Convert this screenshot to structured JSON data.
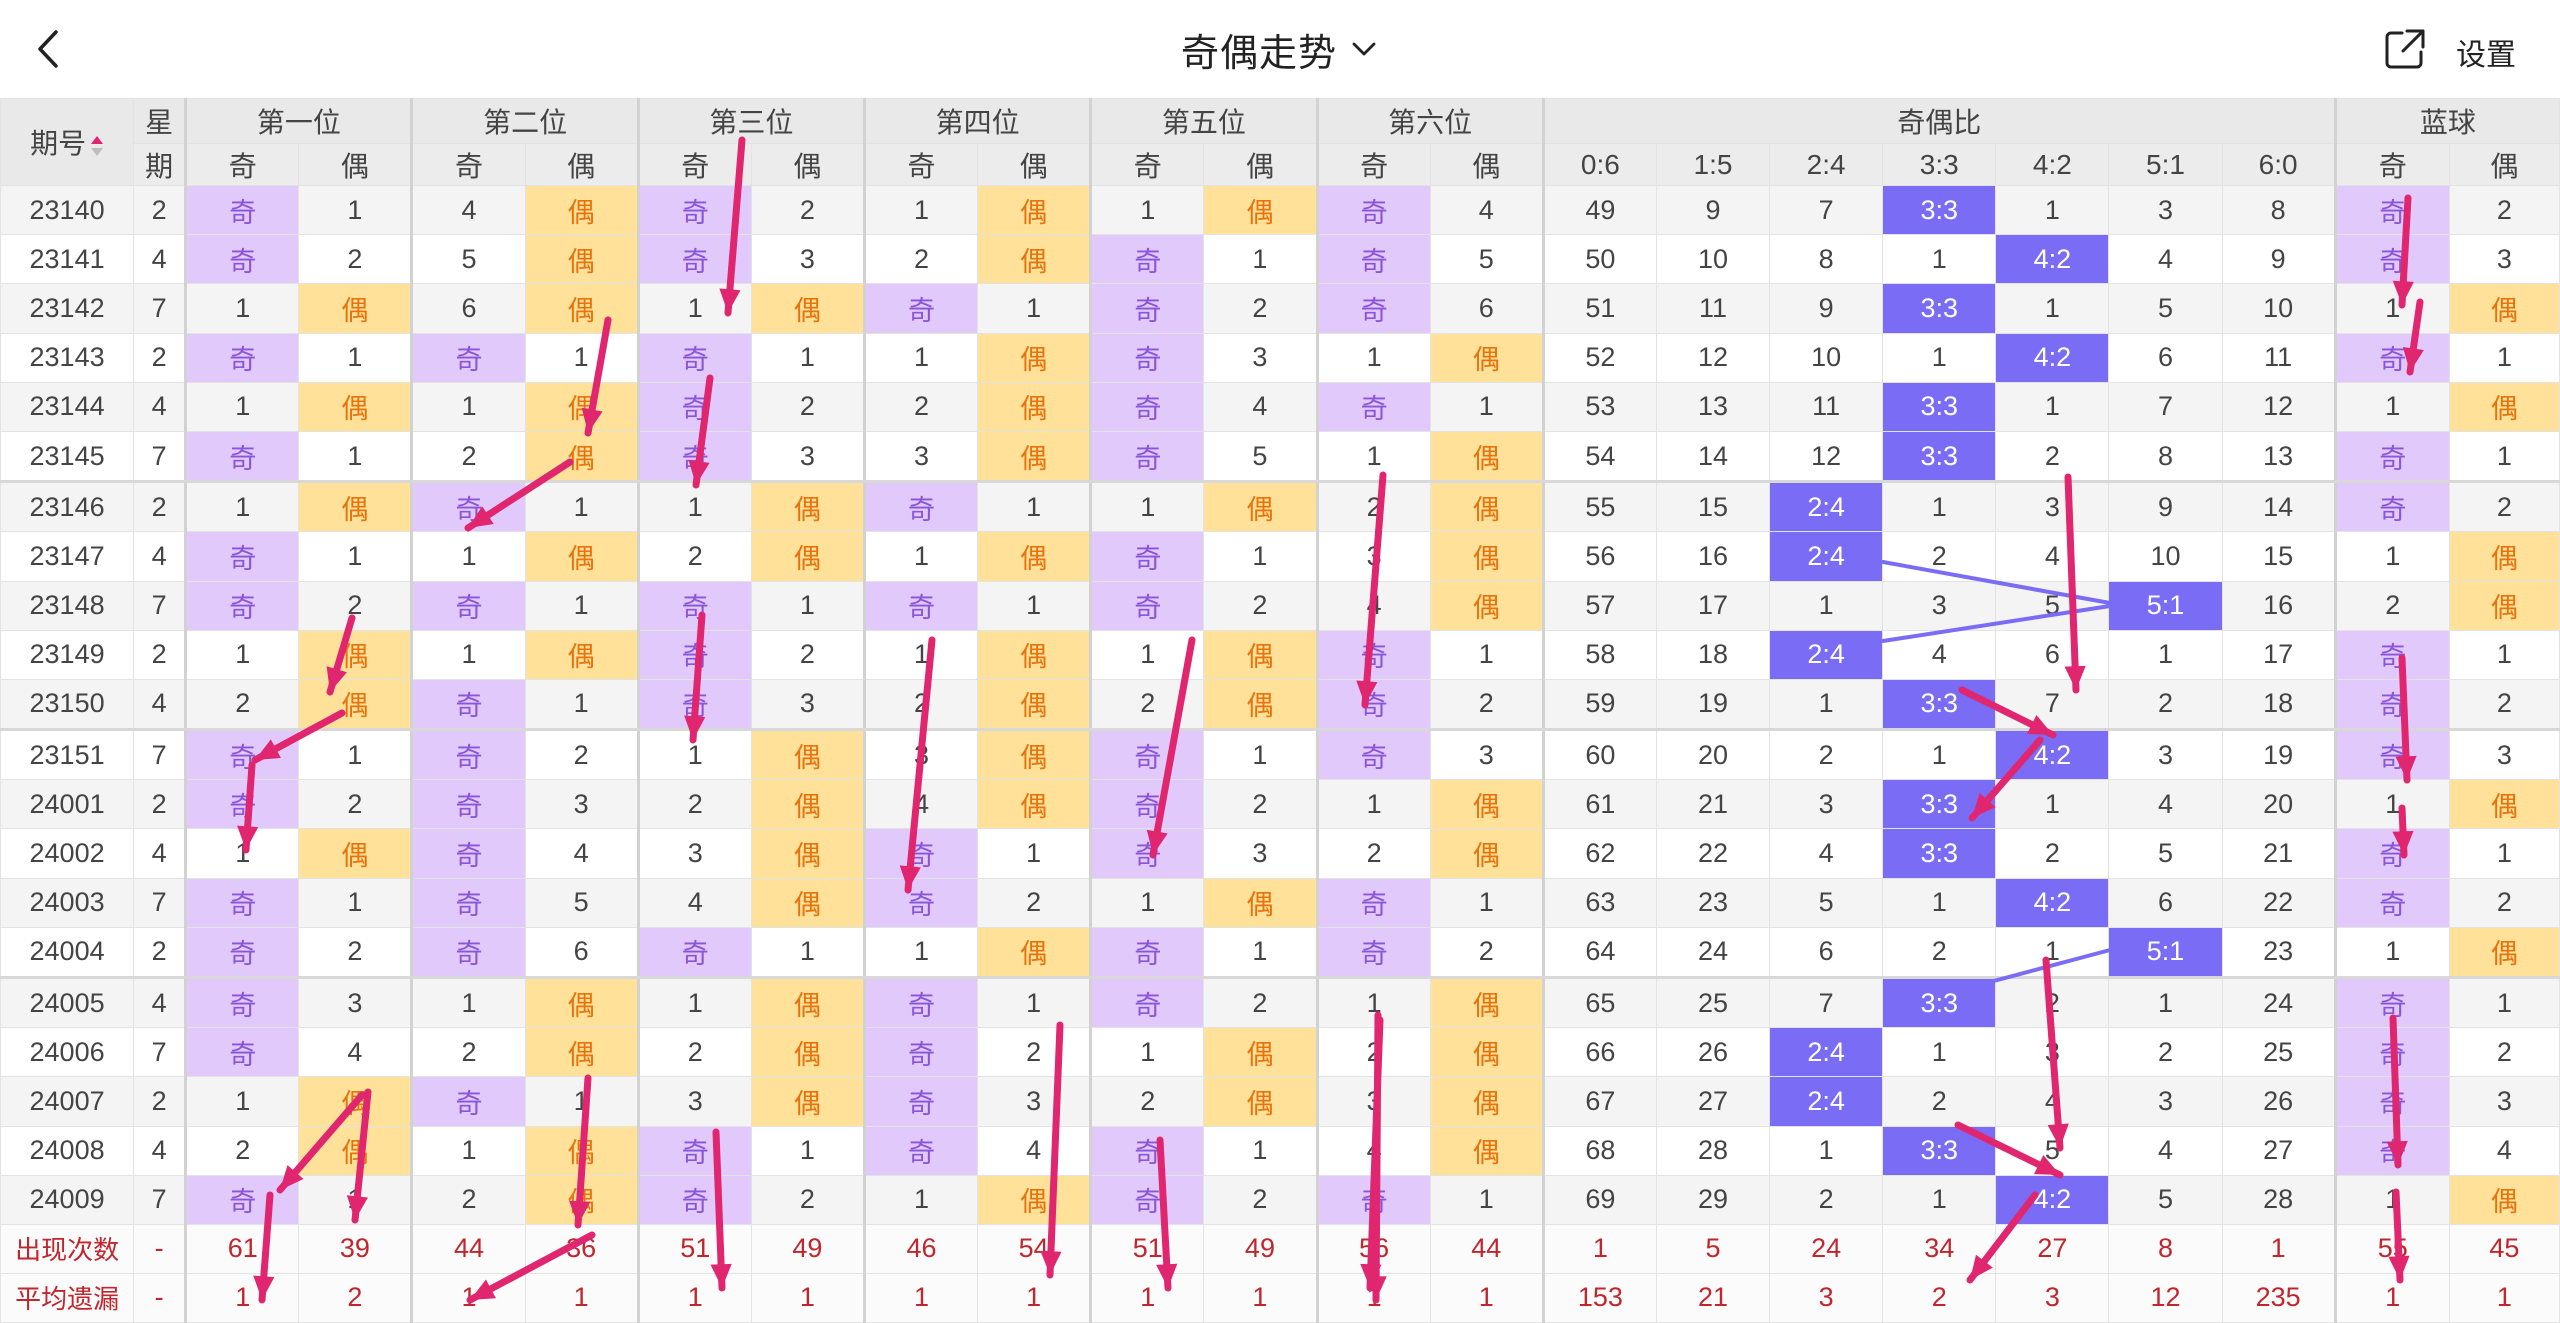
{
  "header": {
    "title": "奇偶走势",
    "settings_label": "设置"
  },
  "table": {
    "col_issue": "期号",
    "col_star_top": "星",
    "col_star_bottom": "期",
    "position_groups": [
      "第一位",
      "第二位",
      "第三位",
      "第四位",
      "第五位",
      "第六位"
    ],
    "odd_label": "奇",
    "even_label": "偶",
    "ratio_group": "奇偶比",
    "ratio_cols": [
      "0:6",
      "1:5",
      "2:4",
      "3:3",
      "4:2",
      "5:1",
      "6:0"
    ],
    "blue_group": "蓝球",
    "rows": [
      {
        "issue": "23140",
        "star": "2",
        "p": [
          "奇",
          1,
          4,
          "偶",
          "奇",
          2,
          1,
          "偶",
          1,
          "偶",
          "奇",
          4
        ],
        "r": [
          49,
          9,
          7,
          "3:3",
          1,
          3,
          8
        ],
        "b": [
          "奇",
          2
        ]
      },
      {
        "issue": "23141",
        "star": "4",
        "p": [
          "奇",
          2,
          5,
          "偶",
          "奇",
          3,
          2,
          "偶",
          "奇",
          1,
          "奇",
          5
        ],
        "r": [
          50,
          10,
          8,
          1,
          "4:2",
          4,
          9
        ],
        "b": [
          "奇",
          3
        ]
      },
      {
        "issue": "23142",
        "star": "7",
        "p": [
          1,
          "偶",
          6,
          "偶",
          1,
          "偶",
          "奇",
          1,
          "奇",
          2,
          "奇",
          6
        ],
        "r": [
          51,
          11,
          9,
          "3:3",
          1,
          5,
          10
        ],
        "b": [
          1,
          "偶"
        ]
      },
      {
        "issue": "23143",
        "star": "2",
        "p": [
          "奇",
          1,
          "奇",
          1,
          "奇",
          1,
          1,
          "偶",
          "奇",
          3,
          1,
          "偶"
        ],
        "r": [
          52,
          12,
          10,
          1,
          "4:2",
          6,
          11
        ],
        "b": [
          "奇",
          1
        ]
      },
      {
        "issue": "23144",
        "star": "4",
        "p": [
          1,
          "偶",
          1,
          "偶",
          "奇",
          2,
          2,
          "偶",
          "奇",
          4,
          "奇",
          1
        ],
        "r": [
          53,
          13,
          11,
          "3:3",
          1,
          7,
          12
        ],
        "b": [
          1,
          "偶"
        ]
      },
      {
        "issue": "23145",
        "star": "7",
        "p": [
          "奇",
          1,
          2,
          "偶",
          "奇",
          3,
          3,
          "偶",
          "奇",
          5,
          1,
          "偶"
        ],
        "r": [
          54,
          14,
          12,
          "3:3",
          2,
          8,
          13
        ],
        "b": [
          "奇",
          1
        ]
      },
      {
        "issue": "23146",
        "star": "2",
        "p": [
          1,
          "偶",
          "奇",
          1,
          1,
          "偶",
          "奇",
          1,
          1,
          "偶",
          2,
          "偶"
        ],
        "r": [
          55,
          15,
          "2:4",
          1,
          3,
          9,
          14
        ],
        "b": [
          "奇",
          2
        ]
      },
      {
        "issue": "23147",
        "star": "4",
        "p": [
          "奇",
          1,
          1,
          "偶",
          2,
          "偶",
          1,
          "偶",
          "奇",
          1,
          3,
          "偶"
        ],
        "r": [
          56,
          16,
          "2:4",
          2,
          4,
          10,
          15
        ],
        "b": [
          1,
          "偶"
        ]
      },
      {
        "issue": "23148",
        "star": "7",
        "p": [
          "奇",
          2,
          "奇",
          1,
          "奇",
          1,
          "奇",
          1,
          "奇",
          2,
          4,
          "偶"
        ],
        "r": [
          57,
          17,
          1,
          3,
          5,
          "5:1",
          16
        ],
        "b": [
          2,
          "偶"
        ]
      },
      {
        "issue": "23149",
        "star": "2",
        "p": [
          1,
          "偶",
          1,
          "偶",
          "奇",
          2,
          1,
          "偶",
          1,
          "偶",
          "奇",
          1
        ],
        "r": [
          58,
          18,
          "2:4",
          4,
          6,
          1,
          17
        ],
        "b": [
          "奇",
          1
        ]
      },
      {
        "issue": "23150",
        "star": "4",
        "p": [
          2,
          "偶",
          "奇",
          1,
          "奇",
          3,
          2,
          "偶",
          2,
          "偶",
          "奇",
          2
        ],
        "r": [
          59,
          19,
          1,
          "3:3",
          7,
          2,
          18
        ],
        "b": [
          "奇",
          2
        ]
      },
      {
        "issue": "23151",
        "star": "7",
        "p": [
          "奇",
          1,
          "奇",
          2,
          1,
          "偶",
          3,
          "偶",
          "奇",
          1,
          "奇",
          3
        ],
        "r": [
          60,
          20,
          2,
          1,
          "4:2",
          3,
          19
        ],
        "b": [
          "奇",
          3
        ]
      },
      {
        "issue": "24001",
        "star": "2",
        "p": [
          "奇",
          2,
          "奇",
          3,
          2,
          "偶",
          4,
          "偶",
          "奇",
          2,
          1,
          "偶"
        ],
        "r": [
          61,
          21,
          3,
          "3:3",
          1,
          4,
          20
        ],
        "b": [
          1,
          "偶"
        ]
      },
      {
        "issue": "24002",
        "star": "4",
        "p": [
          1,
          "偶",
          "奇",
          4,
          3,
          "偶",
          "奇",
          1,
          "奇",
          3,
          2,
          "偶"
        ],
        "r": [
          62,
          22,
          4,
          "3:3",
          2,
          5,
          21
        ],
        "b": [
          "奇",
          1
        ]
      },
      {
        "issue": "24003",
        "star": "7",
        "p": [
          "奇",
          1,
          "奇",
          5,
          4,
          "偶",
          "奇",
          2,
          1,
          "偶",
          "奇",
          1
        ],
        "r": [
          63,
          23,
          5,
          1,
          "4:2",
          6,
          22
        ],
        "b": [
          "奇",
          2
        ]
      },
      {
        "issue": "24004",
        "star": "2",
        "p": [
          "奇",
          2,
          "奇",
          6,
          "奇",
          1,
          1,
          "偶",
          "奇",
          1,
          "奇",
          2
        ],
        "r": [
          64,
          24,
          6,
          2,
          1,
          "5:1",
          23
        ],
        "b": [
          1,
          "偶"
        ]
      },
      {
        "issue": "24005",
        "star": "4",
        "p": [
          "奇",
          3,
          1,
          "偶",
          1,
          "偶",
          "奇",
          1,
          "奇",
          2,
          1,
          "偶"
        ],
        "r": [
          65,
          25,
          7,
          "3:3",
          2,
          1,
          24
        ],
        "b": [
          "奇",
          1
        ]
      },
      {
        "issue": "24006",
        "star": "7",
        "p": [
          "奇",
          4,
          2,
          "偶",
          2,
          "偶",
          "奇",
          2,
          1,
          "偶",
          2,
          "偶"
        ],
        "r": [
          66,
          26,
          "2:4",
          1,
          3,
          2,
          25
        ],
        "b": [
          "奇",
          2
        ]
      },
      {
        "issue": "24007",
        "star": "2",
        "p": [
          1,
          "偶",
          "奇",
          1,
          3,
          "偶",
          "奇",
          3,
          2,
          "偶",
          3,
          "偶"
        ],
        "r": [
          67,
          27,
          "2:4",
          2,
          4,
          3,
          26
        ],
        "b": [
          "奇",
          3
        ]
      },
      {
        "issue": "24008",
        "star": "4",
        "p": [
          2,
          "偶",
          1,
          "偶",
          "奇",
          1,
          "奇",
          4,
          "奇",
          1,
          4,
          "偶"
        ],
        "r": [
          68,
          28,
          1,
          "3:3",
          5,
          4,
          27
        ],
        "b": [
          "奇",
          4
        ]
      },
      {
        "issue": "24009",
        "star": "7",
        "p": [
          "奇",
          1,
          2,
          "偶",
          "奇",
          2,
          1,
          "偶",
          "奇",
          2,
          "奇",
          1
        ],
        "r": [
          69,
          29,
          2,
          1,
          "4:2",
          5,
          28
        ],
        "b": [
          1,
          "偶"
        ]
      }
    ],
    "stats": [
      {
        "label": "出现次数",
        "star": "-",
        "p": [
          61,
          39,
          44,
          36,
          51,
          49,
          46,
          54,
          51,
          49,
          56,
          44
        ],
        "r": [
          1,
          5,
          24,
          34,
          27,
          8,
          1
        ],
        "b": [
          55,
          45
        ]
      },
      {
        "label": "平均遗漏",
        "star": "-",
        "p": [
          1,
          2,
          1,
          1,
          1,
          1,
          1,
          1,
          1,
          1,
          1,
          1
        ],
        "r": [
          153,
          21,
          3,
          2,
          3,
          12,
          235
        ],
        "b": [
          1,
          1
        ]
      }
    ]
  },
  "colors": {
    "odd_bg": "#e2c9fb",
    "odd_text": "#8a55d8",
    "even_bg": "#ffe19a",
    "even_text": "#e8730c",
    "ratio_bg": "#7a6cf5",
    "stat_text": "#c0262c",
    "annotation_arrow": "#e0266e",
    "trend_line": "#7a6cf5"
  },
  "icons": [
    "back-arrow-icon",
    "chevron-down-icon",
    "share-icon",
    "sort-arrows-icon"
  ]
}
